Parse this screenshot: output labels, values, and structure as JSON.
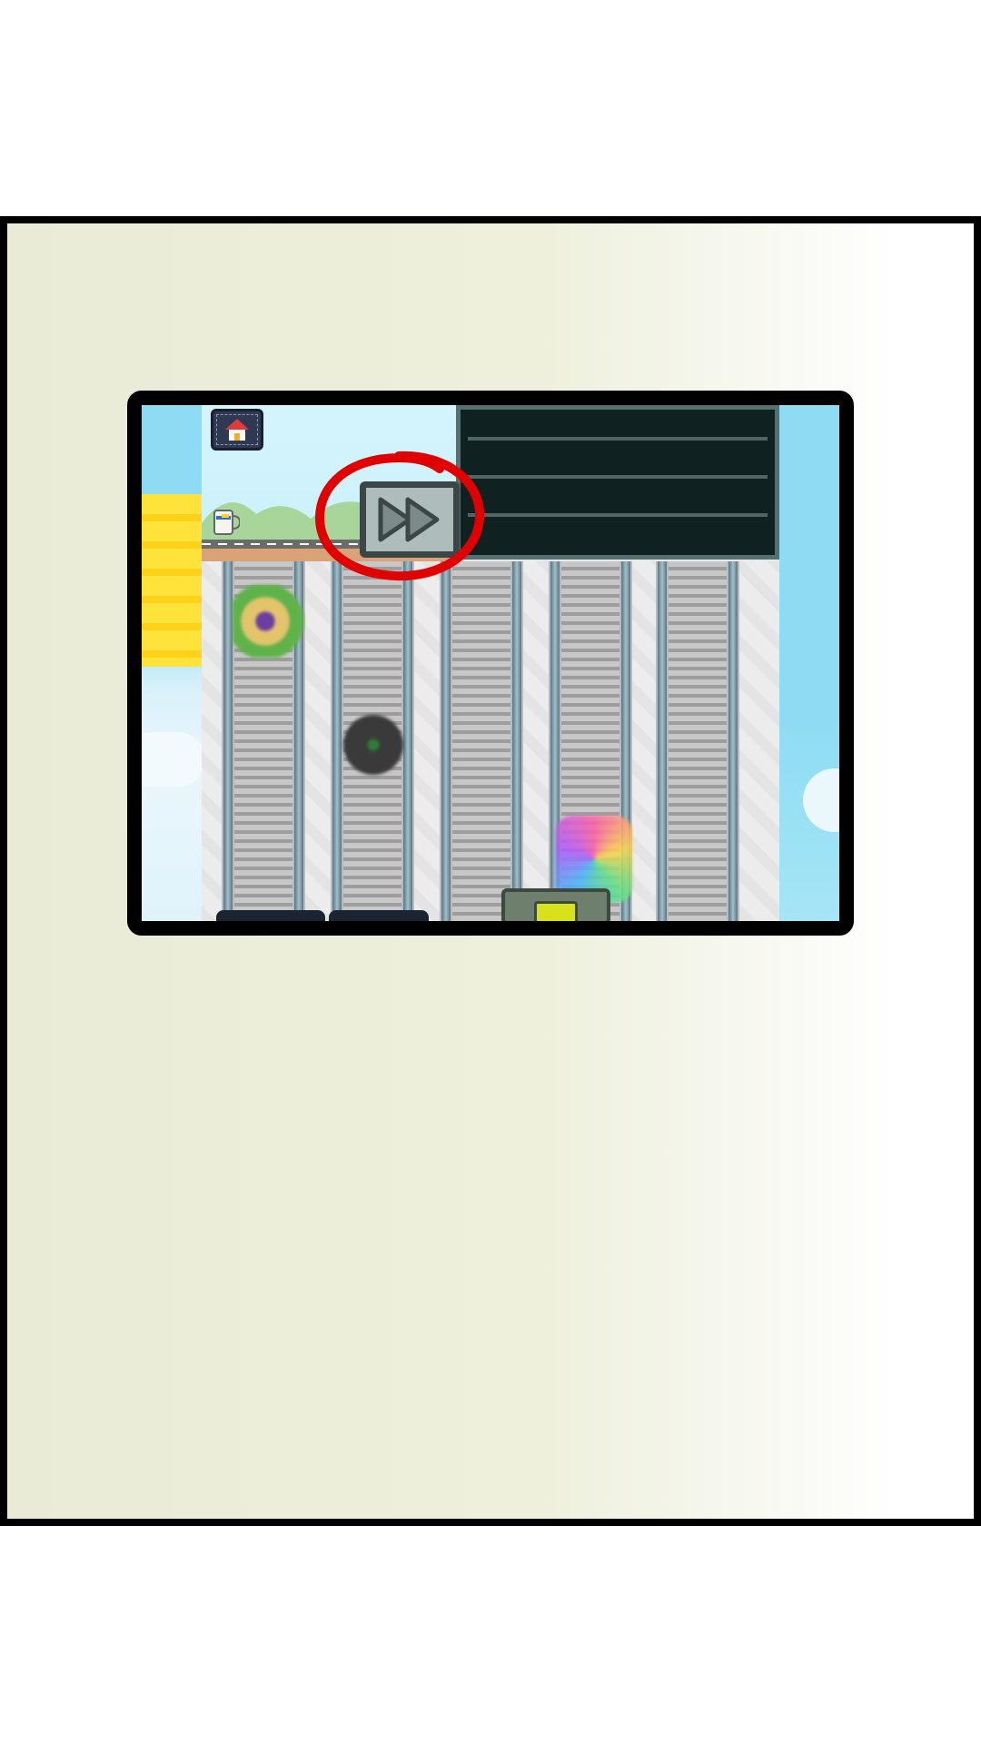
{
  "game": {
    "buttons": {
      "home": {
        "icon": "house-icon"
      },
      "fast_forward": {
        "icon": "fast-forward-icon"
      }
    },
    "annotation": {
      "shape": "red-circle",
      "color": "#e00000",
      "target": "fast-forward-button"
    },
    "lane_count": 5,
    "belt_items": [
      {
        "name": "plant-box-item",
        "lane": 1
      },
      {
        "name": "dark-gift-item",
        "lane": 2
      },
      {
        "name": "rainbow-box-item",
        "lane": 4
      }
    ]
  },
  "colors": {
    "frame": "#000000",
    "sky": "#8ddcf3",
    "board": "#0f2221",
    "annotation": "#e00000",
    "sign": "#ffd21a"
  }
}
